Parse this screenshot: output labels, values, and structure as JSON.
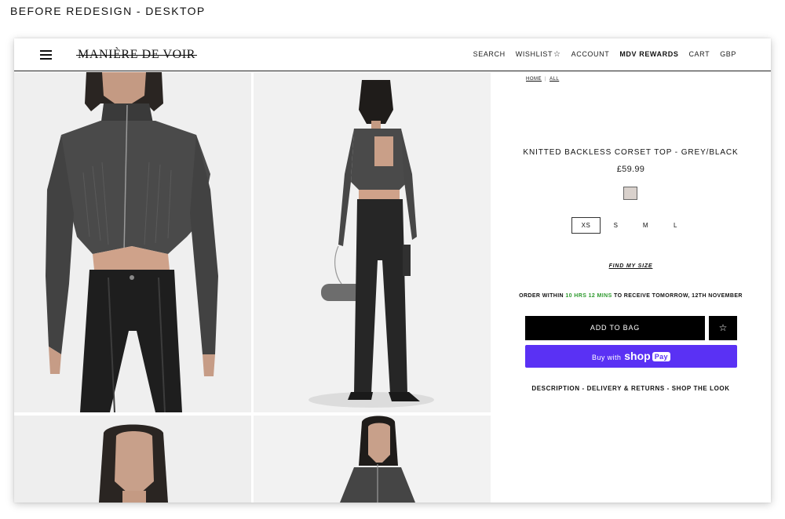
{
  "caption": "BEFORE REDESIGN - DESKTOP",
  "header": {
    "logo": "MANIÈRE DE VOIR",
    "nav": [
      {
        "label": "SEARCH",
        "bold": false
      },
      {
        "label": "WISHLIST",
        "bold": false,
        "icon": "star-icon"
      },
      {
        "label": "ACCOUNT",
        "bold": false
      },
      {
        "label": "MDV REWARDS",
        "bold": true
      },
      {
        "label": "CART",
        "bold": false
      },
      {
        "label": "GBP",
        "bold": false
      }
    ]
  },
  "breadcrumb": {
    "home": "HOME",
    "all": "ALL",
    "sep": "|"
  },
  "product": {
    "title": "KNITTED BACKLESS CORSET TOP - GREY/BLACK",
    "price": "£59.99",
    "swatch_color": "#d9d1cc",
    "sizes": [
      "XS",
      "S",
      "M",
      "L"
    ],
    "selected_size": "XS",
    "find_size": "FIND MY SIZE",
    "order_prefix": "ORDER WITHIN",
    "order_time": "10 HRS 12 MINS",
    "order_suffix": "TO RECEIVE TOMORROW, 12TH NOVEMBER",
    "add_to_bag": "ADD TO BAG",
    "shoppay_prefix": "Buy with",
    "shoppay_brand": "shop",
    "shoppay_pay": "Pay",
    "links": [
      "DESCRIPTION",
      "DELIVERY & RETURNS",
      "SHOP THE LOOK"
    ],
    "links_sep": "-"
  },
  "colors": {
    "accent_green": "#2e9a2e",
    "shoppay": "#5a31f4",
    "button": "#000000"
  }
}
